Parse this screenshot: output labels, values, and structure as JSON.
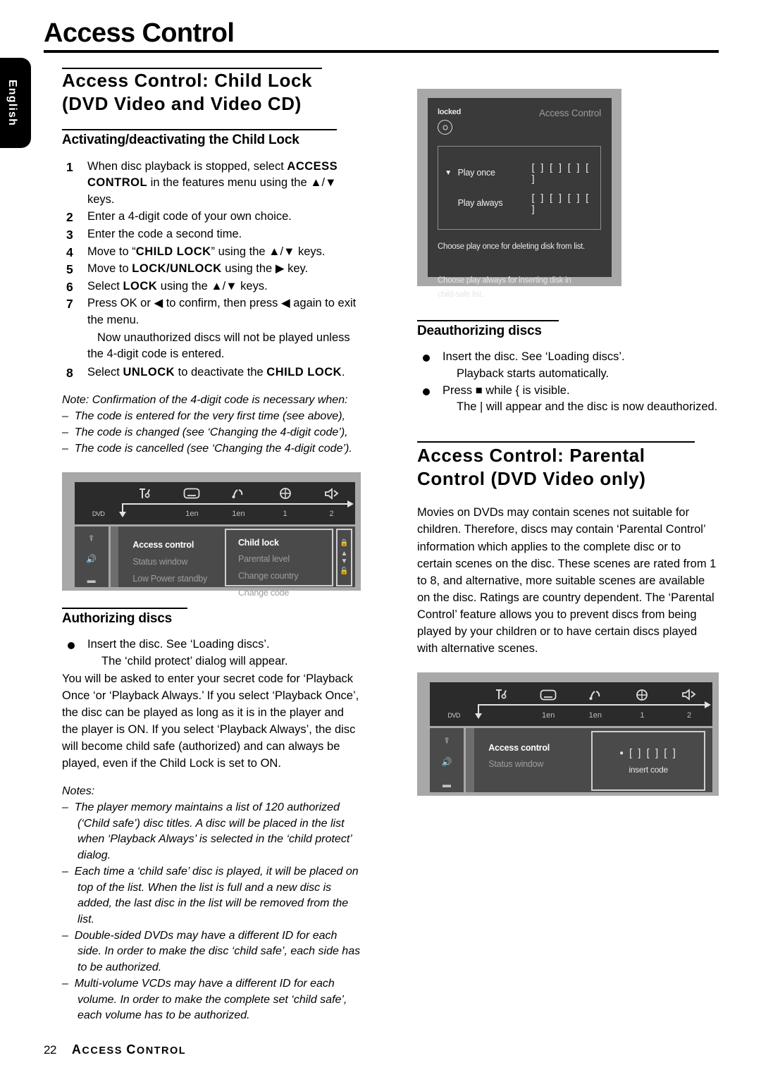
{
  "language_tab": "English",
  "page_title": "Access Control",
  "left_column": {
    "section_heading_line1": "Access Control: Child Lock",
    "section_heading_line2": "(DVD Video and Video CD)",
    "subheading": "Activating/deactivating the Child Lock",
    "steps": [
      {
        "num": "1",
        "html": "When disc playback is stopped, select <b>ACCESS CONTROL</b> in the features menu using the ▲/▼ keys."
      },
      {
        "num": "2",
        "html": "Enter a 4-digit code of your own choice."
      },
      {
        "num": "3",
        "html": "Enter the code a second time."
      },
      {
        "num": "4",
        "html": "Move to “<b>CHILD LOCK</b>” using the ▲/▼ keys."
      },
      {
        "num": "5",
        "html": "Move to <b>LOCK/UNLOCK</b> using the ▶ key."
      },
      {
        "num": "6",
        "html": "Select <b>LOCK</b> using the ▲/▼ keys."
      },
      {
        "num": "7",
        "html": "Press OK or ◀ to confirm, then press ◀ again to exit the menu."
      },
      {
        "num": "8",
        "html": "Select <b>UNLOCK</b> to deactivate the <b>CHILD LOCK</b>."
      }
    ],
    "step7_note": "Now unauthorized discs will not be played unless the 4-digit code is entered.",
    "notes_confirmation": {
      "intro": "Note: Confirmation of the 4-digit code is necessary when:",
      "items": [
        "The code is entered for the very first time (see above),",
        "The code is changed (see ‘Changing the 4-digit code’),",
        "The code is cancelled (see ‘Changing the 4-digit code’)."
      ]
    },
    "menu_shot": {
      "values": [
        "DVD",
        "",
        "1en",
        "1en",
        "1",
        "2"
      ],
      "left_pane_icons": [
        "disc-eject-icon",
        "speaker-icon",
        "display-icon"
      ],
      "middle_items": [
        "Access control",
        "Status window",
        "Low Power standby"
      ],
      "right_items": [
        "Child lock",
        "Parental level",
        "Change country",
        "Change code"
      ],
      "scroll_icons": [
        "lock-icon",
        "up-down-arrows-icon",
        "unlock-icon"
      ]
    },
    "authorizing": {
      "heading": "Authorizing discs",
      "bullet": "Insert the disc. See ‘Loading discs’.",
      "bullet_sub": "The ‘child protect’ dialog will appear.",
      "paragraph": "You will be asked to enter your secret code for ‘Playback Once ‘or ‘Playback Always.’ If you select ‘Playback Once’, the disc can be played as long as it is in the player and the player is ON. If you select ‘Playback Always’, the disc will become child safe (authorized) and can always be played, even if the Child Lock is set to ON."
    },
    "notes_list": {
      "heading": "Notes:",
      "items": [
        "The player memory maintains a list of 120 authorized (‘Child safe’) disc titles. A disc will be placed in the list when ‘Playback Always’ is selected in the ‘child protect’ dialog.",
        "Each time a ‘child safe’ disc is played, it will be placed on top of the list. When the list is full and a new disc is added, the last disc in the list will be removed from the list.",
        "Double-sided DVDs may have a different ID for each side. In order to make the disc ‘child safe’, each side has to be authorized.",
        "Multi-volume VCDs may have a different ID for each volume. In order to make the complete set ‘child safe’, each volume has to be authorized."
      ]
    }
  },
  "right_column": {
    "lock_shot": {
      "status": "locked",
      "title": "Access Control",
      "options": [
        {
          "marker": "▼",
          "label": "Play once",
          "code": "[ ] [ ] [ ] [ ]"
        },
        {
          "marker": "",
          "label": "Play always",
          "code": "[ ] [ ] [ ] [ ]"
        }
      ],
      "hint1": "Choose play once for deleting  disk from list.",
      "hint2_line1": "Choose play always for inserting disk in",
      "hint2_line2": "child-safe list."
    },
    "deauthorizing": {
      "heading": "Deauthorizing discs",
      "bullet1": "Insert the disc. See ‘Loading discs’.",
      "bullet1_sub": "Playback starts automatically.",
      "bullet2": "Press ■ while {   is visible.",
      "bullet2_sub": "The |   will appear and the disc is now deauthorized."
    },
    "parental": {
      "heading_line1": "Access Control: Parental",
      "heading_line2": "Control (DVD Video only)",
      "paragraph": "Movies on DVDs may contain scenes not suitable for children. Therefore, discs may contain ‘Parental Control’ information which applies to the complete disc or to certain scenes on the disc. These scenes are rated from 1 to 8, and alternative, more suitable scenes are available on the disc. Ratings are country dependent. The ‘Parental Control’ feature allows you to prevent discs from being played by your children or to have certain discs played with alternative scenes."
    },
    "code_shot": {
      "values": [
        "DVD",
        "",
        "1en",
        "1en",
        "1",
        "2"
      ],
      "middle_items": [
        "Access control",
        "Status window"
      ],
      "code_boxes": "▪ [ ] [ ] [ ]",
      "code_label": "insert code"
    }
  },
  "footer": {
    "page_number": "22",
    "title_caps": "A",
    "title_rest": "CCESS ",
    "title_caps2": "C",
    "title_rest2": "ONTROL"
  }
}
